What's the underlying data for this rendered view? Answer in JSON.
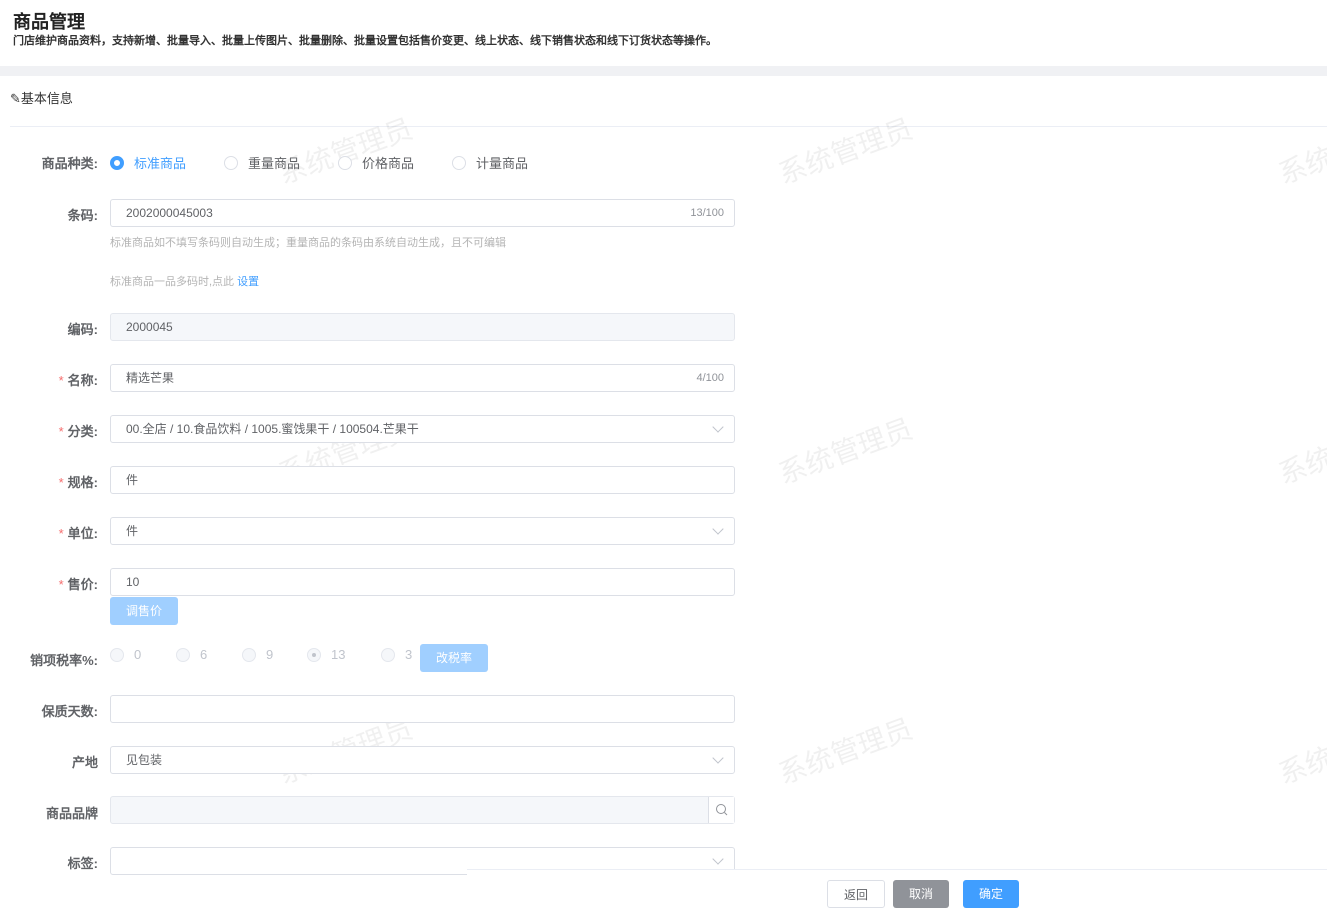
{
  "header": {
    "title": "商品管理",
    "description": "门店维护商品资料，支持新增、批量导入、批量上传图片、批量删除、批量设置包括售价变更、线上状态、线下销售状态和线下订货状态等操作。"
  },
  "section": {
    "title": "基本信息"
  },
  "watermark": "系统管理员",
  "form": {
    "type": {
      "label": "商品种类:",
      "options": [
        "标准商品",
        "重量商品",
        "价格商品",
        "计量商品"
      ],
      "selected": "标准商品"
    },
    "barcode": {
      "label": "条码:",
      "value": "2002000045003",
      "count": "13/100",
      "tip1": "标准商品如不填写条码则自动生成；重量商品的条码由系统自动生成，且不可编辑",
      "tip2": "标准商品一品多码时,点此",
      "tip2_link": "设置"
    },
    "code": {
      "label": "编码:",
      "value": "2000045"
    },
    "name": {
      "label": "名称:",
      "value": "精选芒果",
      "count": "4/100"
    },
    "category": {
      "label": "分类:",
      "value": "00.全店 / 10.食品饮料 / 1005.蜜饯果干 / 100504.芒果干"
    },
    "spec": {
      "label": "规格:",
      "value": "件"
    },
    "unit": {
      "label": "单位:",
      "value": "件"
    },
    "price": {
      "label": "售价:",
      "value": "10",
      "button": "调售价"
    },
    "tax": {
      "label": "销项税率%:",
      "options": [
        "0",
        "6",
        "9",
        "13",
        "3"
      ],
      "selected": "13",
      "button": "改税率"
    },
    "shelf_life": {
      "label": "保质天数:",
      "value": ""
    },
    "origin": {
      "label": "产地",
      "value": "见包装"
    },
    "brand": {
      "label": "商品品牌",
      "value": ""
    },
    "tag": {
      "label": "标签:",
      "value": ""
    }
  },
  "footer": {
    "back": "返回",
    "cancel": "取消",
    "confirm": "确定"
  }
}
